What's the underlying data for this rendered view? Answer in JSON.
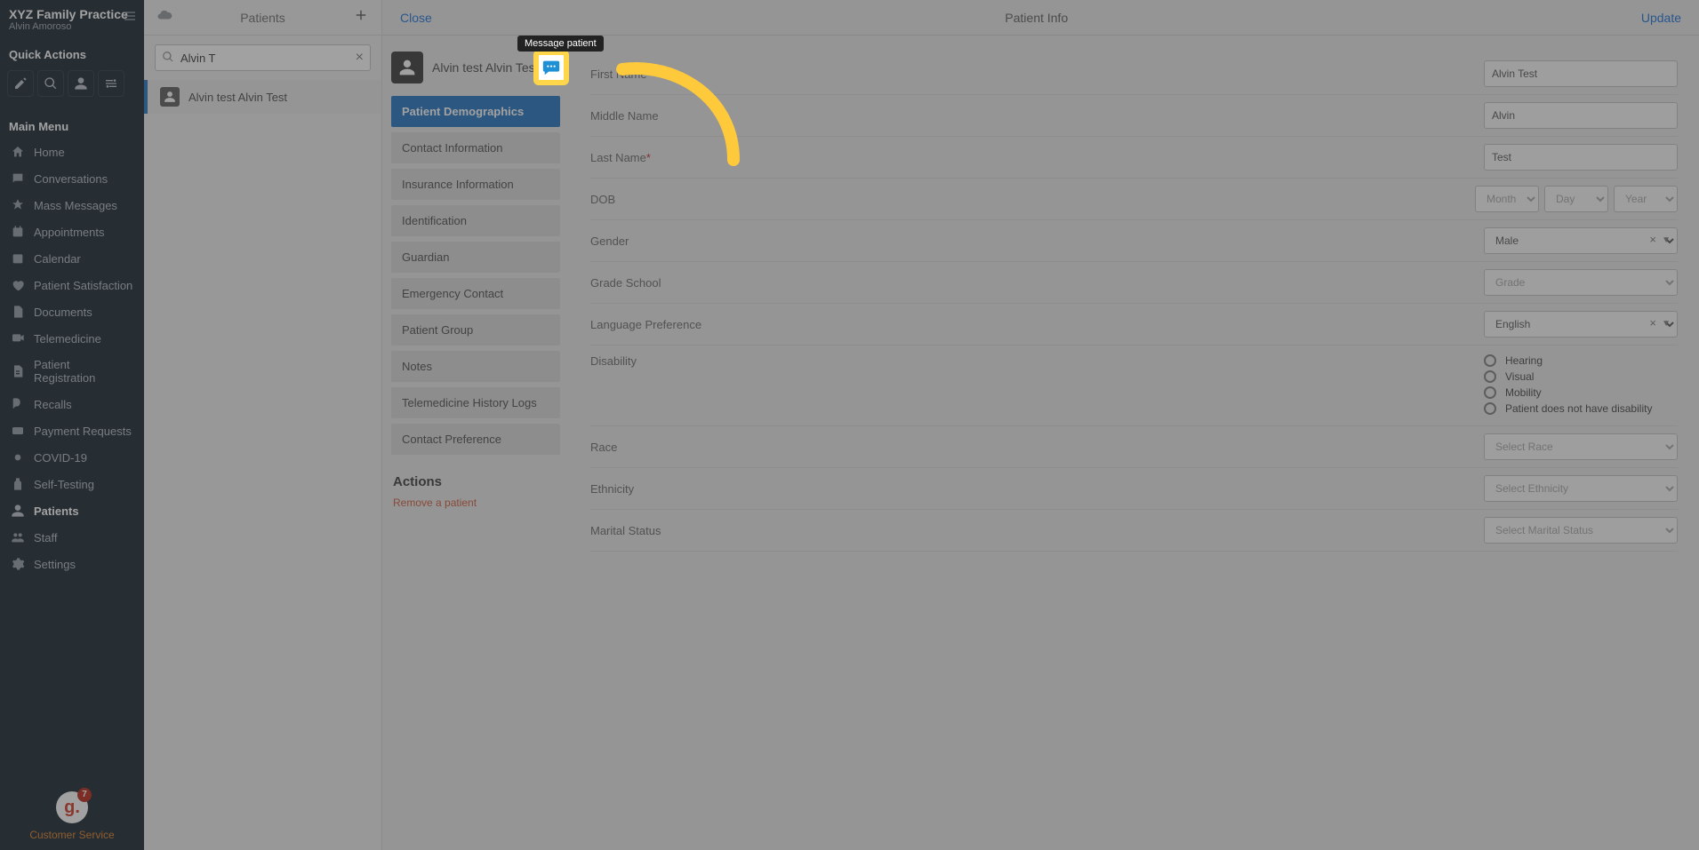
{
  "sidebar": {
    "practice": "XYZ Family Practice",
    "user": "Alvin Amoroso",
    "quick_actions_title": "Quick Actions",
    "main_menu_title": "Main Menu",
    "menu": [
      {
        "icon": "home",
        "label": "Home"
      },
      {
        "icon": "chat",
        "label": "Conversations"
      },
      {
        "icon": "mass",
        "label": "Mass Messages"
      },
      {
        "icon": "appt",
        "label": "Appointments"
      },
      {
        "icon": "cal",
        "label": "Calendar"
      },
      {
        "icon": "heart",
        "label": "Patient Satisfaction"
      },
      {
        "icon": "doc",
        "label": "Documents"
      },
      {
        "icon": "tele",
        "label": "Telemedicine"
      },
      {
        "icon": "reg",
        "label": "Patient Registration"
      },
      {
        "icon": "recall",
        "label": "Recalls"
      },
      {
        "icon": "pay",
        "label": "Payment Requests"
      },
      {
        "icon": "covid",
        "label": "COVID-19"
      },
      {
        "icon": "self",
        "label": "Self-Testing"
      },
      {
        "icon": "patients",
        "label": "Patients",
        "active": true
      },
      {
        "icon": "staff",
        "label": "Staff"
      },
      {
        "icon": "settings",
        "label": "Settings"
      }
    ],
    "footer_badge": "7",
    "footer_label": "Customer Service"
  },
  "patients_col": {
    "title": "Patients",
    "search_value": "Alvin T",
    "result": "Alvin test Alvin Test"
  },
  "detail": {
    "close": "Close",
    "title": "Patient Info",
    "update": "Update",
    "patient_name": "Alvin test Alvin Test",
    "tooltip": "Message patient",
    "sections": [
      "Patient Demographics",
      "Contact Information",
      "Insurance Information",
      "Identification",
      "Guardian",
      "Emergency Contact",
      "Patient Group",
      "Notes",
      "Telemedicine History Logs",
      "Contact Preference"
    ],
    "actions_title": "Actions",
    "remove": "Remove a patient",
    "form": {
      "first_name": {
        "label": "First Name",
        "required": true,
        "value": "Alvin Test"
      },
      "middle_name": {
        "label": "Middle Name",
        "value": "Alvin"
      },
      "last_name": {
        "label": "Last Name",
        "required": true,
        "value": "Test"
      },
      "dob": {
        "label": "DOB",
        "month": "Month",
        "day": "Day",
        "year": "Year"
      },
      "gender": {
        "label": "Gender",
        "value": "Male"
      },
      "grade": {
        "label": "Grade School",
        "placeholder": "Grade"
      },
      "language": {
        "label": "Language Preference",
        "value": "English"
      },
      "disability": {
        "label": "Disability",
        "options": [
          "Hearing",
          "Visual",
          "Mobility",
          "Patient does not have disability"
        ]
      },
      "race": {
        "label": "Race",
        "placeholder": "Select Race"
      },
      "ethnicity": {
        "label": "Ethnicity",
        "placeholder": "Select Ethnicity"
      },
      "marital": {
        "label": "Marital Status",
        "placeholder": "Select Marital Status"
      }
    }
  }
}
